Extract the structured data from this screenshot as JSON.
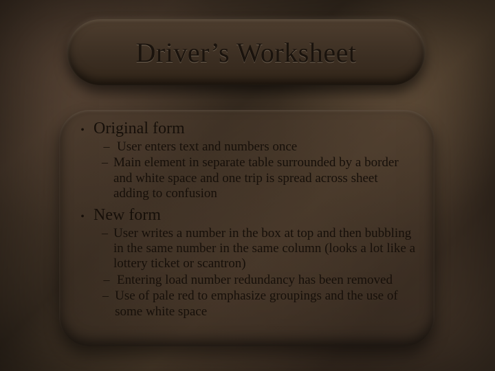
{
  "title": "Driver’s Worksheet",
  "bullets": [
    {
      "label": "Original form",
      "sub": [
        "User enters text and numbers once",
        "Main element in separate table surrounded by a border and white space and one trip is spread across sheet adding to confusion"
      ]
    },
    {
      "label": "New form",
      "sub": [
        "User writes a number in the box at top and then bubbling in the same number in the same column (looks a lot like a lottery ticket or scantron)",
        "Entering load number redundancy has been removed",
        "Use of pale red to emphasize groupings and the use of some white space"
      ]
    }
  ]
}
